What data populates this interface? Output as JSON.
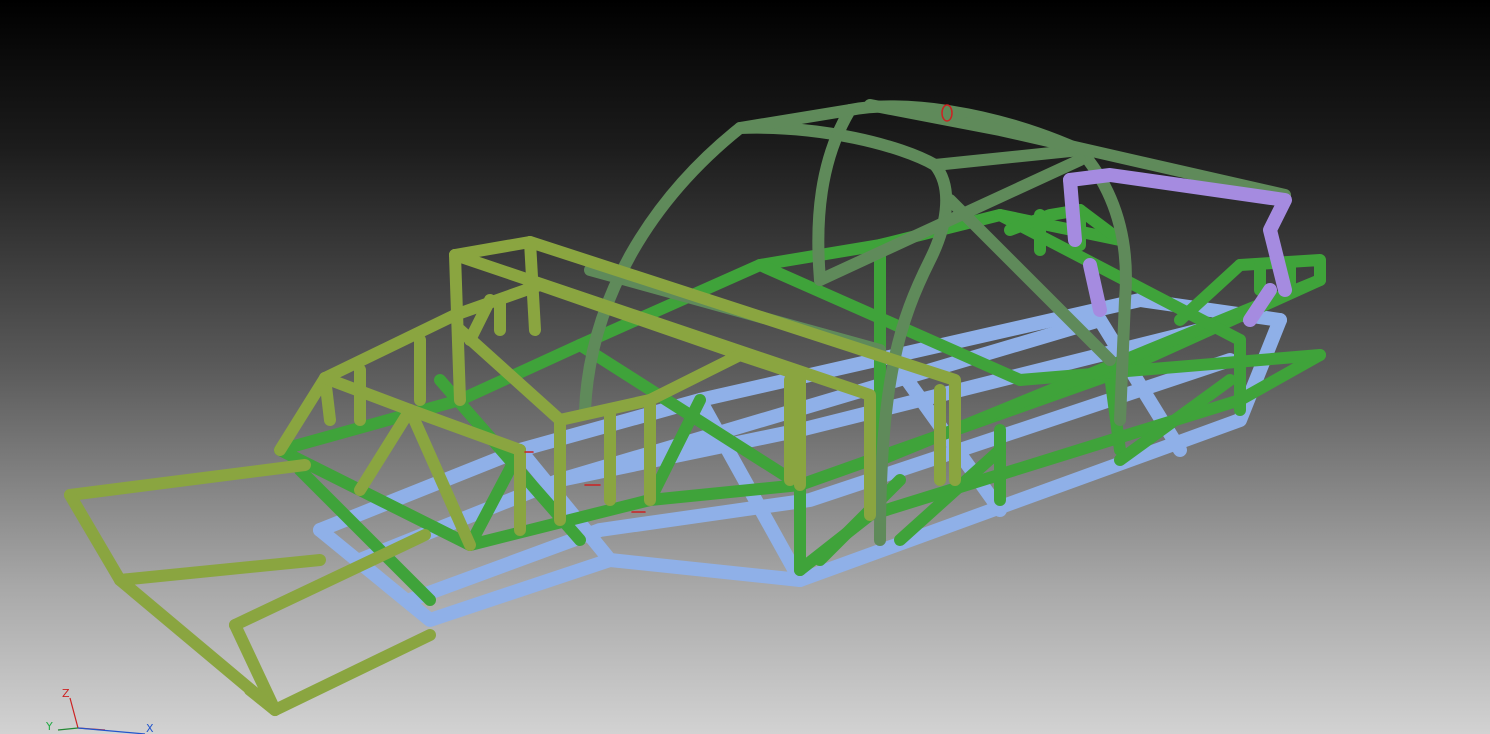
{
  "viewport": {
    "axis_triad": {
      "z_label": "Z",
      "y_label": "Y",
      "x_label": "X"
    }
  },
  "colors": {
    "roll_cage": "#5f8a5a",
    "main_frame": "#3fa33a",
    "front_frame": "#8aa540",
    "floor_frame": "#8fb0e8",
    "rear_bracket": "#a58be0",
    "axis_red": "#cc2222",
    "axis_blue": "#2255cc",
    "axis_green": "#228833"
  }
}
